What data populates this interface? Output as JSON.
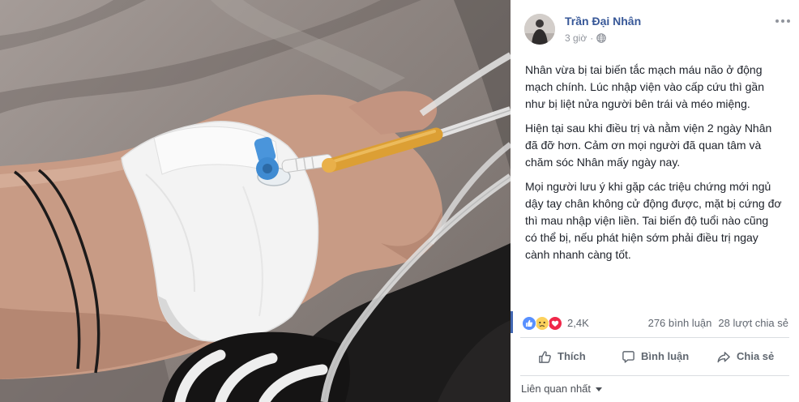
{
  "post": {
    "author_name": "Trần Đại Nhân",
    "avatar_icon": "avatar-photo",
    "timestamp": "3 giờ",
    "separator": "·",
    "privacy_icon": "globe-icon",
    "menu_icon": "more-options-icon",
    "paragraphs": [
      [
        "Nhân vừa bị tai biến tắc mạch máu não ở động",
        "mạch chính. Lúc nhập viện vào cấp cứu thì gần",
        "như bị liệt nửa người bên trái và méo miệng."
      ],
      [
        "Hiện tại sau khi điều trị và nằm viện 2 ngày Nhân",
        "đã đỡ hơn. Cảm ơn mọi người đã quan tâm và",
        "chăm sóc Nhân mấy ngày nay."
      ],
      [
        "Mọi người lưu ý khi gặp các triệu chứng mới ngủ",
        "dậy tay chân không cử động được, mặt bị cứng đơ",
        "thì mau nhập viện liền. Tai biến độ tuổi nào cũng",
        "có thể bị, nếu phát hiện sớm phải điều trị ngay",
        "cành nhanh càng tốt."
      ]
    ]
  },
  "reactions": {
    "icons": [
      "like-icon",
      "sad-icon",
      "love-icon"
    ],
    "count": "2,4K",
    "comments": "276 bình luận",
    "shares": "28 lượt chia sẻ"
  },
  "actions": [
    {
      "label": "Thích",
      "icon": "thumbs-up-icon"
    },
    {
      "label": "Bình luận",
      "icon": "comment-icon"
    },
    {
      "label": "Chia sẻ",
      "icon": "share-icon"
    }
  ],
  "comment_sort": {
    "label": "Liên quan nhất",
    "icon": "caret-down-icon"
  },
  "colors": {
    "author_link": "#385898",
    "accent": "#4267b2",
    "muted_text": "#90949c",
    "body_text": "#1d2129",
    "action_text": "#606770",
    "like": "#5890ff",
    "love": "#f0284a",
    "sad": "#fcd15c"
  }
}
